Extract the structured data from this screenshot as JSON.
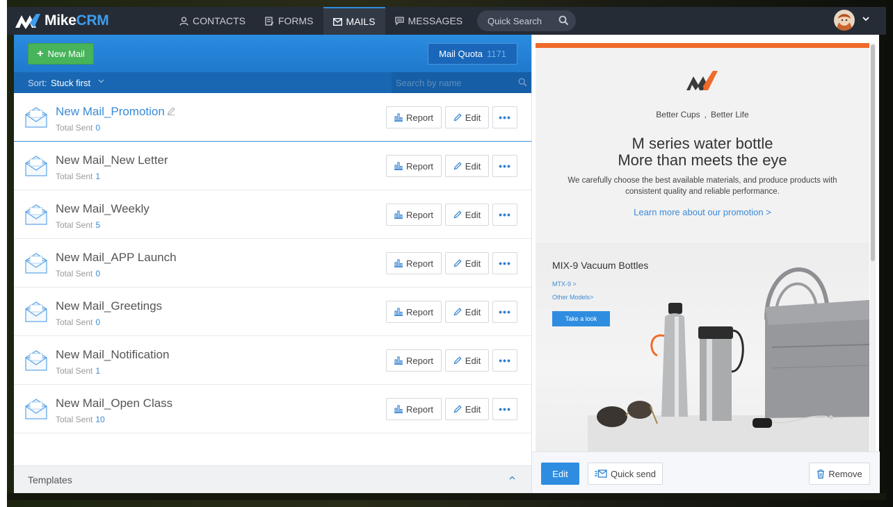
{
  "app": {
    "logo_text_a": "Mike",
    "logo_text_b": "CRM"
  },
  "nav": {
    "items": [
      {
        "label": "CONTACTS",
        "icon": "person-icon"
      },
      {
        "label": "FORMS",
        "icon": "form-icon"
      },
      {
        "label": "MAILS",
        "icon": "mail-icon",
        "active": true
      },
      {
        "label": "MESSAGES",
        "icon": "message-icon"
      }
    ],
    "search_label": "Quick Search"
  },
  "toolbar": {
    "new_mail": "New Mail",
    "quota_label": "Mail Quota",
    "quota_value": "1171"
  },
  "sortbar": {
    "label": "Sort:",
    "value": "Stuck first",
    "search_placeholder": "Search by name"
  },
  "mails": [
    {
      "name": "New Mail_Promotion",
      "sent_label": "Total Sent",
      "sent": "0",
      "selected": true
    },
    {
      "name": "New Mail_New Letter",
      "sent_label": "Total Sent",
      "sent": "1"
    },
    {
      "name": "New Mail_Weekly",
      "sent_label": "Total Sent",
      "sent": "5"
    },
    {
      "name": "New Mail_APP Launch",
      "sent_label": "Total Sent",
      "sent": "0"
    },
    {
      "name": "New Mail_Greetings",
      "sent_label": "Total Sent",
      "sent": "0"
    },
    {
      "name": "New Mail_Notification",
      "sent_label": "Total Sent",
      "sent": "1"
    },
    {
      "name": "New Mail_Open Class",
      "sent_label": "Total Sent",
      "sent": "10"
    }
  ],
  "row_buttons": {
    "report": "Report",
    "edit": "Edit",
    "more": "•••"
  },
  "templates": {
    "label": "Templates"
  },
  "preview": {
    "slogan": "Better Cups , Better Life",
    "title_line1": "M series water bottle",
    "title_line2": "More than meets the eye",
    "description": "We carefully choose the best available materials, and produce products with consistent quality and reliable performance.",
    "link": "Learn more about our promotion >",
    "product_title": "MIX-9 Vacuum Bottles",
    "product_link1": "MTX-9 >",
    "product_link2": "Other Models>",
    "product_button": "Take a look",
    "accent_color": "#f06a2a"
  },
  "actions": {
    "edit": "Edit",
    "quick_send": "Quick send",
    "remove": "Remove"
  },
  "colors": {
    "brand_blue": "#2e8de0",
    "new_mail_green": "#47b35a",
    "topbar": "#262c35"
  }
}
